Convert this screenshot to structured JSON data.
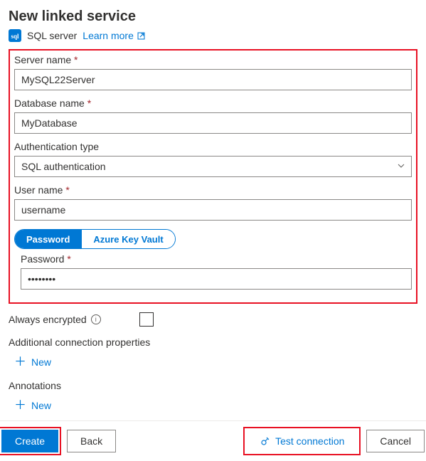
{
  "header": {
    "title": "New linked service",
    "service_type": "SQL server",
    "learn_more": "Learn more"
  },
  "fields": {
    "server_name": {
      "label": "Server name",
      "value": "MySQL22Server"
    },
    "database_name": {
      "label": "Database name",
      "value": "MyDatabase"
    },
    "auth_type": {
      "label": "Authentication type",
      "value": "SQL authentication"
    },
    "user_name": {
      "label": "User name",
      "value": "username"
    },
    "password_toggle": {
      "opt1": "Password",
      "opt2": "Azure Key Vault"
    },
    "password": {
      "label": "Password",
      "value": "••••••••"
    },
    "always_encrypted": "Always encrypted",
    "addl_props": "Additional connection properties",
    "annotations": "Annotations",
    "add_new": "New"
  },
  "footer": {
    "create": "Create",
    "back": "Back",
    "test": "Test connection",
    "cancel": "Cancel"
  }
}
